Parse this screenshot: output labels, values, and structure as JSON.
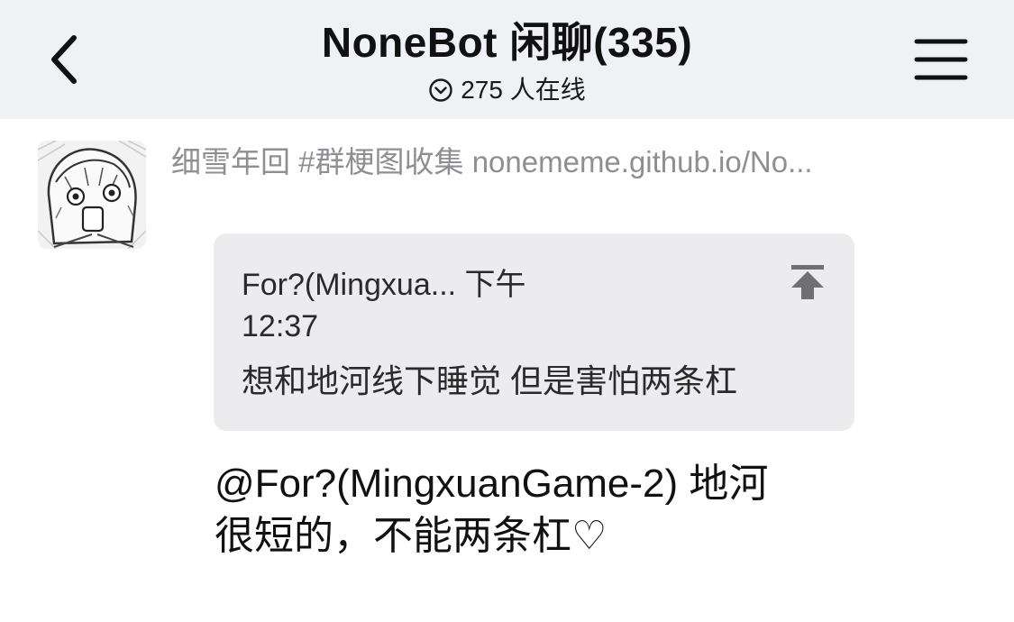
{
  "header": {
    "title": "NoneBot 闲聊(335)",
    "online_count": "275",
    "online_suffix": "人在线",
    "back_icon": "chevron-left-icon",
    "menu_icon": "hamburger-menu-icon",
    "online_icon": "chevron-down-circle-icon"
  },
  "message": {
    "sender": "细雪年回 #群梗图收集 nonememe.github.io/No...",
    "avatar_icon": "anime-avatar-image",
    "quote": {
      "author": "For?(Mingxua...",
      "time_label": "下午",
      "time": "12:37",
      "text": "想和地河线下睡觉 但是害怕两条杠",
      "jump_icon": "jump-to-top-icon"
    },
    "text_line1": "@For?(MingxuanGame-2) 地河",
    "text_line2": "很短的，不能两条杠♡"
  }
}
